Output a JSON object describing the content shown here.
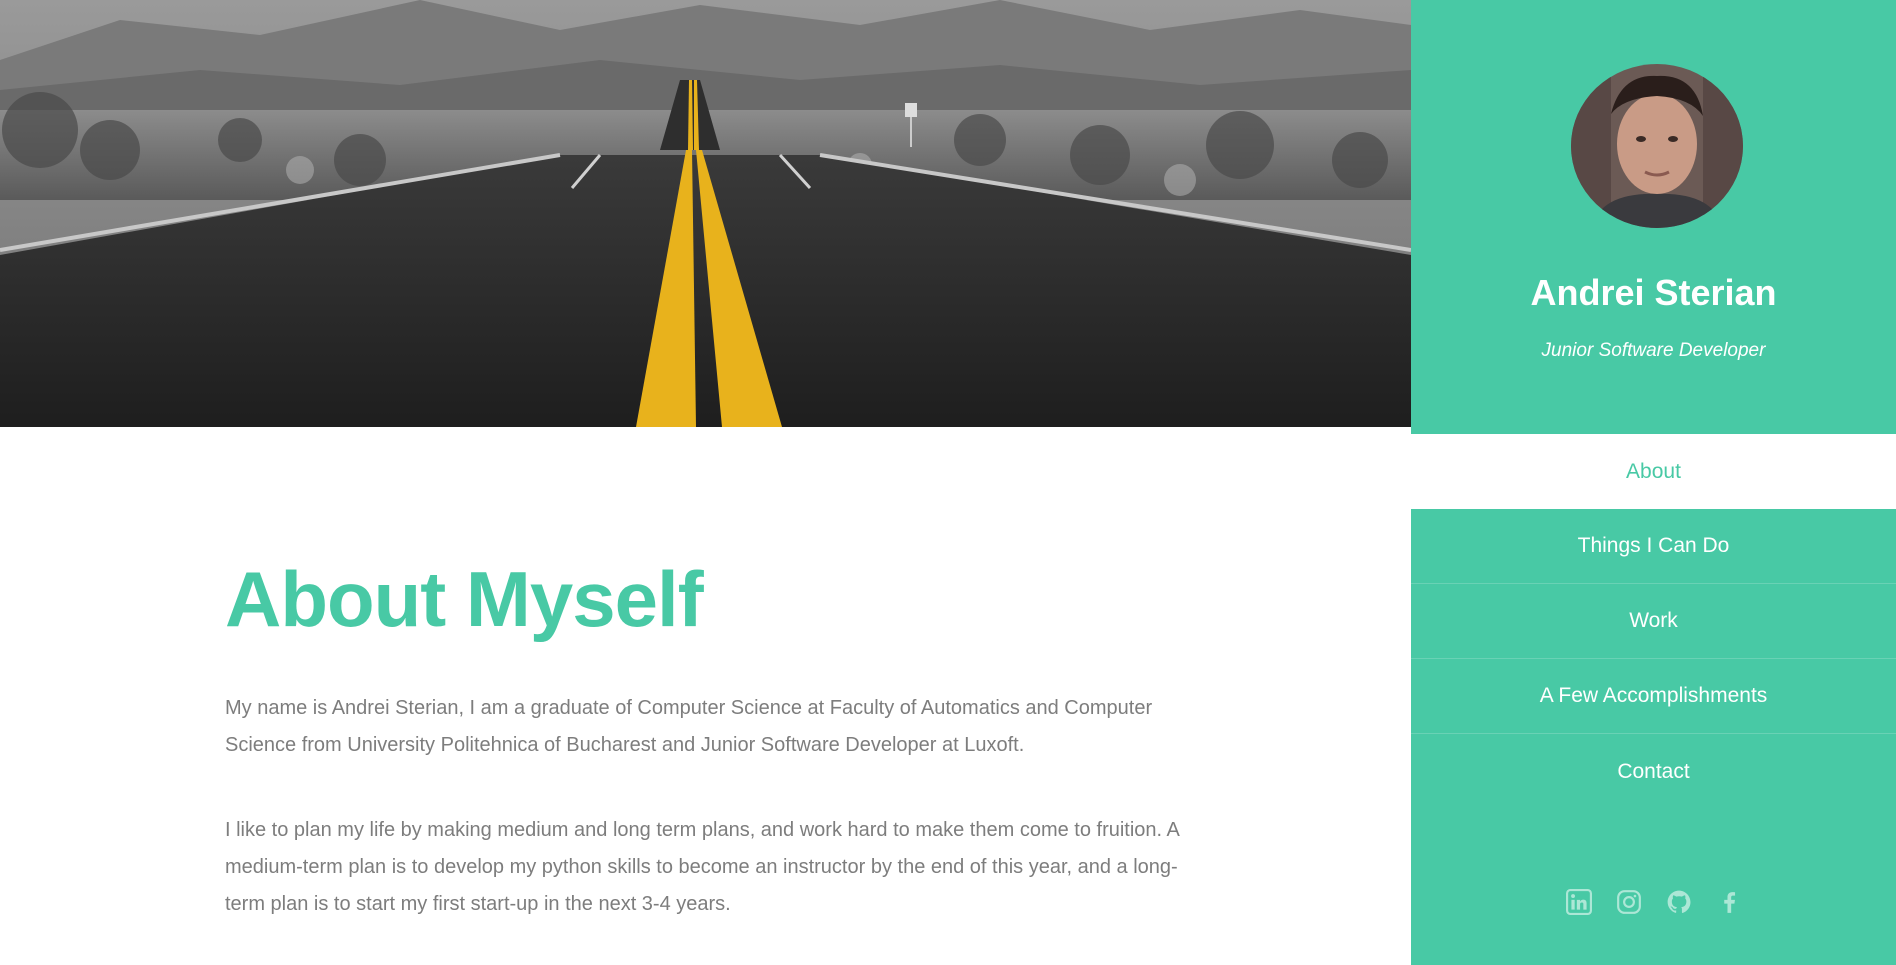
{
  "profile": {
    "name": "Andrei Sterian",
    "role": "Junior Software Developer"
  },
  "nav": {
    "items": [
      {
        "label": "About",
        "active": true
      },
      {
        "label": "Things I Can Do",
        "active": false
      },
      {
        "label": "Work",
        "active": false
      },
      {
        "label": "A Few Accomplishments",
        "active": false
      },
      {
        "label": "Contact",
        "active": false
      }
    ]
  },
  "about": {
    "title": "About Myself",
    "paragraphs": [
      "My name is Andrei Sterian, I am a graduate of Computer Science at Faculty of Automatics and Computer Science from University Politehnica of Bucharest and Junior Software Developer at Luxoft.",
      "I like to plan my life by making medium and long term plans, and work hard to make them come to fruition. A medium-term plan is to develop my python skills to become an instructor by the end of this year, and a long-term plan is to start my first start-up in the next 3-4 years."
    ]
  },
  "social": {
    "icons": [
      "linkedin-icon",
      "instagram-icon",
      "github-icon",
      "facebook-icon"
    ]
  },
  "colors": {
    "accent": "#48c9a5",
    "text": "#7d7d7d",
    "road_stripe": "#e8b21c"
  }
}
